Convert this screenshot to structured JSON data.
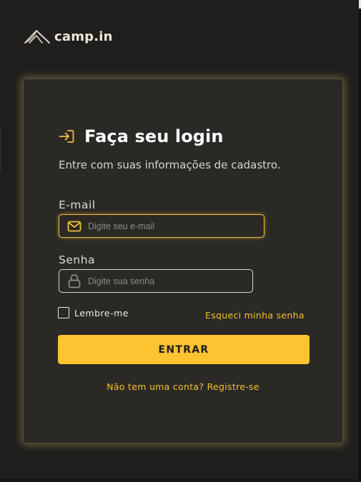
{
  "brand": {
    "name": "camp.in",
    "logo_icon": "tent-icon"
  },
  "login": {
    "title": "Faça seu login",
    "title_icon": "login-arrow-icon",
    "subtitle": "Entre com suas informações de cadastro.",
    "email": {
      "label": "E-mail",
      "placeholder": "Digite seu e-mail",
      "value": "",
      "icon": "mail-icon"
    },
    "password": {
      "label": "Senha",
      "placeholder": "Digite sua senha",
      "value": "",
      "icon": "lock-icon"
    },
    "remember_label": "Lembre-me",
    "remember_checked": false,
    "forgot_link": "Esqueci minha senha",
    "submit_label": "ENTRAR",
    "register_link": "Não tem uma conta? Registre-se"
  },
  "colors": {
    "background": "#1f1e1c",
    "card": "#2a2926",
    "accent": "#fdc330",
    "link": "#f6bf2d",
    "focus_border": "#f3be3a"
  }
}
